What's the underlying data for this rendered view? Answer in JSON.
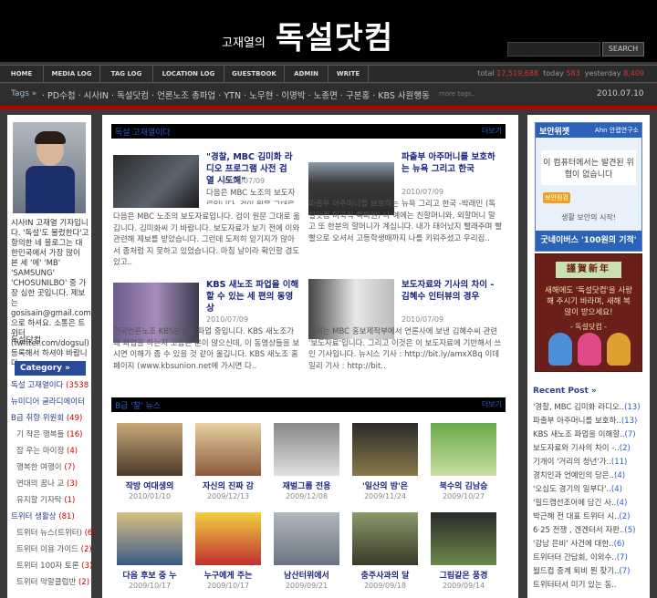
{
  "header": {
    "title_small": "고재열의",
    "title_big": "독설닷컴",
    "search_button": "SEARCH"
  },
  "nav": {
    "items": [
      "HOME",
      "MEDIA LOG",
      "TAG LOG",
      "LOCATION LOG",
      "GUESTBOOK",
      "ADMIN",
      "WRITE"
    ],
    "stats": {
      "total_label": "total",
      "total": "17,519,688",
      "today_label": "today",
      "today": "583",
      "yesterday_label": "yesterday",
      "yesterday": "8,409"
    }
  },
  "tagbar": {
    "label": "Tags »",
    "tags": "· PD수첩 · 시사IN · 독설닷컴 · 언론노조 총파업 · YTN · 노무현 · 이명박 · 노종면 · 구본홍 · KBS 사원행동",
    "more": "more tags..",
    "date": "2010.07.10"
  },
  "sidebar_left": {
    "intro": "시사IN 고재열 기자입니다. '독설'도 물렸한다'고 항의한 네 블로그는 대한민국에서 가장 많이 본 세 '에' 'MB' 'SAMSUNG' 'CHOSUNILBO' 중 가장 심한 곳입니다. 제보는 gosisain@gmail.com 으로 하셔요. 소통은 트위터(twitter.com/dogsul) 등록해서 하셔야 바랍니다.",
    "name": "독설닷컴",
    "category_header": "Category »",
    "categories": [
      {
        "label": "독설 고재열이다",
        "count": "(3538)",
        "level": "top"
      },
      {
        "label": "뉴미디어 글라디에이터",
        "count": "",
        "level": "top"
      },
      {
        "label": "B급 취향 위원회",
        "count": "(49)",
        "level": "top"
      },
      {
        "label": "기 작은 행복들",
        "count": "(16)",
        "level": "sub"
      },
      {
        "label": "잡 우는 마이정",
        "count": "(4)",
        "level": "sub"
      },
      {
        "label": "행복한 여행이",
        "count": "(7)",
        "level": "sub"
      },
      {
        "label": "연대의 꿈나 교",
        "count": "(3)",
        "level": "sub"
      },
      {
        "label": "유지할 기자탁",
        "count": "(1)",
        "level": "sub"
      },
      {
        "label": "트위터 생활상",
        "count": "(81)",
        "level": "top"
      },
      {
        "label": "트위터 뉴스(트위터)",
        "count": "(6)",
        "level": "sub"
      },
      {
        "label": "트위터 이용 가이드",
        "count": "(2)",
        "level": "sub"
      },
      {
        "label": "트위터 100자 토론",
        "count": "(3)",
        "level": "sub"
      },
      {
        "label": "트위터 막말클럽반",
        "count": "(2)",
        "level": "sub"
      }
    ]
  },
  "main": {
    "section1_title": "독설 고재열이다",
    "section1_more": "더보기",
    "articles": [
      {
        "title": "\"경찰, MBC 김미화 라디오 프로그램 사전 검열 시도해\"",
        "date": "2010/07/09",
        "body": "다음은 MBC 노조의 보도자료입니다. 검이 원문 그대로 옮깁니다. 김미화씨 기 바랍니다. 보도자료가 보기 전에 이와 관련해 제보를 받았습니다. 그런데 도저히 믿기지가 않아서 좀처럼 지 못하고 있었습니다. 마침 날이라 확인할 겸도 있고.."
      },
      {
        "title": "파출부 아주머니를 보호하는 뉴욕 그리고 한국",
        "date": "2010/07/09",
        "body": "파출부 아주머니를 보호하는 뉴욕 그리고 한국 -박래민 (독설닷컴 미국식 특파원) 나 예에는 친할머니와, 외할머니 말고 또 한분의 할머니가 계십니다. 내가 태어났지 빨래주며 빨빨으로 오셔서 고등학생때까지 나를 키워주셨고 우리집.."
      },
      {
        "title": "KBS 새노조 파업을 이해할 수 있는 세 편의 동영상",
        "date": "2010/07/09",
        "body": "전국언론노조 KBS본부가 파업 중입니다. KBS 새노조가 왜 파업을 하는지 고음는 분이 많으신데, 이 동영상들을 보시면 이해가 좀 수 있을 것 같아 옮깁니다. KBS 새노조 홈페이지 (www.kbsunion.net에 가시면 다.."
      },
      {
        "title": "보도자료와 기사의 차이 - 김혜수 인터뷰의 경우",
        "date": "2010/07/09",
        "body": "아래는 MBC 홍보제작부에서 언론사에 보낸 김혜수씨 관련 '보도자료'입니다. 그리고 이것은 이 보도자료에 기반해서 쓰인 기사입니다. 뉴시스 기사 : http://bit.ly/amxXBq 이데일리 기사 : http://bit.."
      }
    ],
    "section2_title": "B급 '찰' 뉴스",
    "section2_more": "더보기",
    "gallery": [
      {
        "caption": "작방 여대생의",
        "date": "2010/01/10"
      },
      {
        "caption": "자신의 진짜 감",
        "date": "2009/12/13"
      },
      {
        "caption": "재벌그룹 전용",
        "date": "2009/12/08"
      },
      {
        "caption": "'일산의 밤'은",
        "date": "2009/11/24"
      },
      {
        "caption": "북수의 김남승",
        "date": "2009/10/27"
      },
      {
        "caption": "다음 후보 중 누",
        "date": "2009/10/17"
      },
      {
        "caption": "누구에게 주는",
        "date": "2009/10/17"
      },
      {
        "caption": "남산터위에서",
        "date": "2009/09/21"
      },
      {
        "caption": "충주사과의 달",
        "date": "2009/09/18"
      },
      {
        "caption": "그림같은 풍경",
        "date": "2009/09/14"
      }
    ]
  },
  "sidebar_right": {
    "widget": {
      "title": "보안위젯",
      "brand": "Ahn 안랩연구소",
      "body": "이 컴퓨터에서는 발견된 위협이 없습니다",
      "button": "보안점검",
      "link": "생활 보안의 시작!",
      "footer": "굿네이버스 '100원의 기적'"
    },
    "card": {
      "title": "謹賀新年",
      "text": "새해에도 '독설닷컴'을 사랑해 주시기 바라며, 새해 복 많이 받으세요!",
      "sign": "- 독설닷컴 -"
    },
    "recent_header": "Recent Post »",
    "recent": [
      {
        "title": "'경찰, MBC 김미화 라디오..",
        "count": "(13)"
      },
      {
        "title": "파출부 아주머니를 보호하..",
        "count": "(13)"
      },
      {
        "title": "KBS 새노조 파업을 이해할..",
        "count": "(7)"
      },
      {
        "title": "보도자료와 기사의 차이 -..",
        "count": "(2)"
      },
      {
        "title": "기개이 '거리의 청년'가..",
        "count": "(11)"
      },
      {
        "title": "경치인과 언예인의 당은..",
        "count": "(4)"
      },
      {
        "title": "'오심도 경기의 일부다'..",
        "count": "(4)"
      },
      {
        "title": "'필드캠선조어에 담긴 사..",
        "count": "(4)"
      },
      {
        "title": "박근혜 전 대표 트위터 시..",
        "count": "(2)"
      },
      {
        "title": "6·25 전쟁 , 겐겐터서 자판..",
        "count": "(5)"
      },
      {
        "title": "'강남 은비' 사건에 대한..",
        "count": "(6)"
      },
      {
        "title": "트위터터 간담회, 이외수..",
        "count": "(7)"
      },
      {
        "title": "월드컵 중계 퇴비 뭔 찾기..",
        "count": "(7)"
      },
      {
        "title": "트위터터서 미기 있는 동..",
        "count": ""
      }
    ]
  }
}
